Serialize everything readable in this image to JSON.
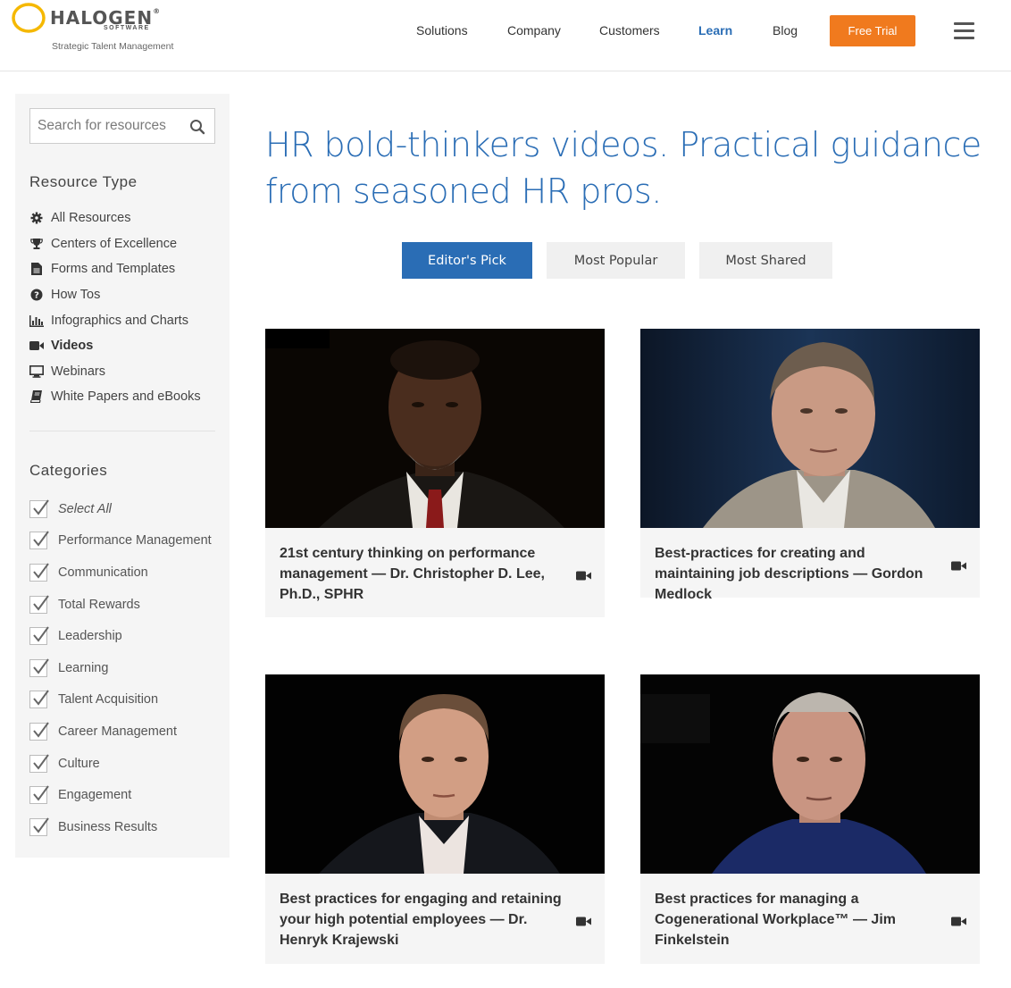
{
  "brand": {
    "name": "HALOGEN",
    "sub": "SOFTWARE",
    "tagline": "Strategic Talent Management",
    "accent": "#f5b800"
  },
  "nav": {
    "items": [
      "Solutions",
      "Company",
      "Customers",
      "Learn",
      "Blog"
    ],
    "active": "Learn",
    "cta": "Free Trial",
    "cta_color": "#f07a1e",
    "menu_icon": "hamburger-icon"
  },
  "sidebar": {
    "search_placeholder": "Search for resources",
    "resource_type_heading": "Resource Type",
    "resource_types": [
      {
        "label": "All Resources",
        "icon": "gear-icon"
      },
      {
        "label": "Centers of Excellence",
        "icon": "trophy-icon"
      },
      {
        "label": "Forms and Templates",
        "icon": "document-icon"
      },
      {
        "label": "How Tos",
        "icon": "question-icon"
      },
      {
        "label": "Infographics and Charts",
        "icon": "bar-chart-icon"
      },
      {
        "label": "Videos",
        "icon": "video-camera-icon",
        "active": true
      },
      {
        "label": "Webinars",
        "icon": "monitor-icon"
      },
      {
        "label": "White Papers and eBooks",
        "icon": "book-icon"
      }
    ],
    "categories_heading": "Categories",
    "categories": [
      {
        "label": "Select All",
        "checked": true
      },
      {
        "label": "Performance Management",
        "checked": true
      },
      {
        "label": "Communication",
        "checked": true
      },
      {
        "label": "Total Rewards",
        "checked": true
      },
      {
        "label": "Leadership",
        "checked": true
      },
      {
        "label": "Learning",
        "checked": true
      },
      {
        "label": "Talent Acquisition",
        "checked": true
      },
      {
        "label": "Career Management",
        "checked": true
      },
      {
        "label": "Culture",
        "checked": true
      },
      {
        "label": "Engagement",
        "checked": true
      },
      {
        "label": "Business Results",
        "checked": true
      }
    ]
  },
  "main": {
    "headline": "HR bold-thinkers videos. Practical guidance from seasoned HR pros.",
    "filters": [
      {
        "label": "Editor's Pick",
        "active": true
      },
      {
        "label": "Most Popular",
        "active": false
      },
      {
        "label": "Most Shared",
        "active": false
      }
    ],
    "cards": [
      {
        "title": "21st century thinking on performance management — Dr. Christopher D. Lee, Ph.D., SPHR",
        "icon": "video-camera-icon"
      },
      {
        "title": "Best-practices for creating and maintaining job descriptions — Gordon Medlock",
        "icon": "video-camera-icon"
      },
      {
        "title": "Best practices for engaging and retaining your high potential employees — Dr. Henryk Krajewski",
        "icon": "video-camera-icon"
      },
      {
        "title": "Best practices for managing a Cogenerational Workplace™ — Jim Finkelstein",
        "icon": "video-camera-icon"
      }
    ]
  }
}
